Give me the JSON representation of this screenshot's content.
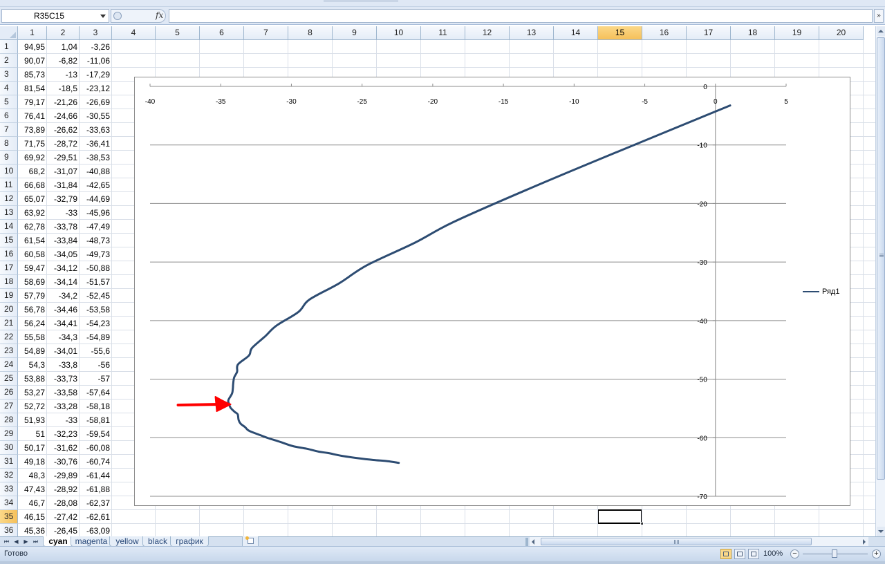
{
  "formula_bar": {
    "name_box": "R35C15",
    "fx_label": "fx",
    "formula": ""
  },
  "columns": [
    "1",
    "2",
    "3",
    "4",
    "5",
    "6",
    "7",
    "8",
    "9",
    "10",
    "11",
    "12",
    "13",
    "14",
    "15",
    "16",
    "17",
    "18",
    "19",
    "20"
  ],
  "active_column": "15",
  "active_row": "35",
  "rows": [
    {
      "n": "1",
      "c1": "94,95",
      "c2": "1,04",
      "c3": "-3,26"
    },
    {
      "n": "2",
      "c1": "90,07",
      "c2": "-6,82",
      "c3": "-11,06"
    },
    {
      "n": "3",
      "c1": "85,73",
      "c2": "-13",
      "c3": "-17,29"
    },
    {
      "n": "4",
      "c1": "81,54",
      "c2": "-18,5",
      "c3": "-23,12"
    },
    {
      "n": "5",
      "c1": "79,17",
      "c2": "-21,26",
      "c3": "-26,69"
    },
    {
      "n": "6",
      "c1": "76,41",
      "c2": "-24,66",
      "c3": "-30,55"
    },
    {
      "n": "7",
      "c1": "73,89",
      "c2": "-26,62",
      "c3": "-33,63"
    },
    {
      "n": "8",
      "c1": "71,75",
      "c2": "-28,72",
      "c3": "-36,41"
    },
    {
      "n": "9",
      "c1": "69,92",
      "c2": "-29,51",
      "c3": "-38,53"
    },
    {
      "n": "10",
      "c1": "68,2",
      "c2": "-31,07",
      "c3": "-40,88"
    },
    {
      "n": "11",
      "c1": "66,68",
      "c2": "-31,84",
      "c3": "-42,65"
    },
    {
      "n": "12",
      "c1": "65,07",
      "c2": "-32,79",
      "c3": "-44,69"
    },
    {
      "n": "13",
      "c1": "63,92",
      "c2": "-33",
      "c3": "-45,96"
    },
    {
      "n": "14",
      "c1": "62,78",
      "c2": "-33,78",
      "c3": "-47,49"
    },
    {
      "n": "15",
      "c1": "61,54",
      "c2": "-33,84",
      "c3": "-48,73"
    },
    {
      "n": "16",
      "c1": "60,58",
      "c2": "-34,05",
      "c3": "-49,73"
    },
    {
      "n": "17",
      "c1": "59,47",
      "c2": "-34,12",
      "c3": "-50,88"
    },
    {
      "n": "18",
      "c1": "58,69",
      "c2": "-34,14",
      "c3": "-51,57"
    },
    {
      "n": "19",
      "c1": "57,79",
      "c2": "-34,2",
      "c3": "-52,45"
    },
    {
      "n": "20",
      "c1": "56,78",
      "c2": "-34,46",
      "c3": "-53,58"
    },
    {
      "n": "21",
      "c1": "56,24",
      "c2": "-34,41",
      "c3": "-54,23"
    },
    {
      "n": "22",
      "c1": "55,58",
      "c2": "-34,3",
      "c3": "-54,89"
    },
    {
      "n": "23",
      "c1": "54,89",
      "c2": "-34,01",
      "c3": "-55,6"
    },
    {
      "n": "24",
      "c1": "54,3",
      "c2": "-33,8",
      "c3": "-56"
    },
    {
      "n": "25",
      "c1": "53,88",
      "c2": "-33,73",
      "c3": "-57"
    },
    {
      "n": "26",
      "c1": "53,27",
      "c2": "-33,58",
      "c3": "-57,64"
    },
    {
      "n": "27",
      "c1": "52,72",
      "c2": "-33,28",
      "c3": "-58,18"
    },
    {
      "n": "28",
      "c1": "51,93",
      "c2": "-33",
      "c3": "-58,81"
    },
    {
      "n": "29",
      "c1": "51",
      "c2": "-32,23",
      "c3": "-59,54"
    },
    {
      "n": "30",
      "c1": "50,17",
      "c2": "-31,62",
      "c3": "-60,08"
    },
    {
      "n": "31",
      "c1": "49,18",
      "c2": "-30,76",
      "c3": "-60,74"
    },
    {
      "n": "32",
      "c1": "48,3",
      "c2": "-29,89",
      "c3": "-61,44"
    },
    {
      "n": "33",
      "c1": "47,43",
      "c2": "-28,92",
      "c3": "-61,88"
    },
    {
      "n": "34",
      "c1": "46,7",
      "c2": "-28,08",
      "c3": "-62,37"
    },
    {
      "n": "35",
      "c1": "46,15",
      "c2": "-27,42",
      "c3": "-62,61"
    },
    {
      "n": "36",
      "c1": "45,36",
      "c2": "-26,45",
      "c3": "-63,09"
    }
  ],
  "sheet_tabs": [
    "cyan",
    "magenta",
    "yellow",
    "black",
    "график"
  ],
  "active_sheet": "cyan",
  "status": {
    "ready": "Готово",
    "zoom": "100%"
  },
  "chart_data": {
    "type": "line",
    "title": "",
    "xlabel": "",
    "ylabel": "",
    "xlim": [
      -40,
      5
    ],
    "ylim": [
      -70,
      0
    ],
    "x_ticks": [
      "-40",
      "-35",
      "-30",
      "-25",
      "-20",
      "-15",
      "-10",
      "-5",
      "0",
      "5"
    ],
    "y_ticks": [
      "0",
      "-10",
      "-20",
      "-30",
      "-40",
      "-50",
      "-60",
      "-70"
    ],
    "grid": "horizontal",
    "legend": "right",
    "line_color": "#2d4c72",
    "annotation": {
      "type": "arrow",
      "color": "#ff0000",
      "points_to": [
        -34.3,
        -54.3
      ]
    },
    "series": [
      {
        "name": "Ряд1",
        "x": [
          1.04,
          -6.82,
          -13,
          -18.5,
          -21.26,
          -24.66,
          -26.62,
          -28.72,
          -29.51,
          -31.07,
          -31.84,
          -32.79,
          -33,
          -33.78,
          -33.84,
          -34.05,
          -34.12,
          -34.14,
          -34.2,
          -34.46,
          -34.41,
          -34.3,
          -34.01,
          -33.8,
          -33.73,
          -33.58,
          -33.28,
          -33,
          -32.23,
          -31.62,
          -30.76,
          -29.89,
          -28.92,
          -28.08,
          -27.42,
          -26.45,
          -25.3,
          -24.2,
          -23.2,
          -22.4
        ],
        "y": [
          -3.26,
          -11.06,
          -17.29,
          -23.12,
          -26.69,
          -30.55,
          -33.63,
          -36.41,
          -38.53,
          -40.88,
          -42.65,
          -44.69,
          -45.96,
          -47.49,
          -48.73,
          -49.73,
          -50.88,
          -51.57,
          -52.45,
          -53.58,
          -54.23,
          -54.89,
          -55.6,
          -56,
          -57,
          -57.64,
          -58.18,
          -58.81,
          -59.54,
          -60.08,
          -60.74,
          -61.44,
          -61.88,
          -62.37,
          -62.61,
          -63.09,
          -63.5,
          -63.8,
          -64.0,
          -64.3
        ]
      }
    ]
  }
}
